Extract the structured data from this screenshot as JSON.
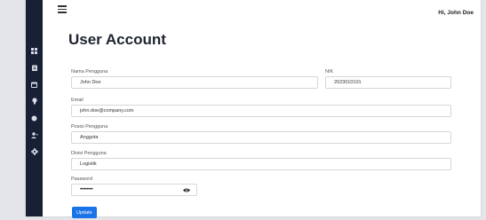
{
  "header": {
    "greeting": "Hi, John Doe"
  },
  "page": {
    "title": "User Account"
  },
  "sidebar": {
    "items": [
      {
        "icon": "grid-icon"
      },
      {
        "icon": "clipboard-icon"
      },
      {
        "icon": "calendar-icon"
      },
      {
        "icon": "lightbulb-icon"
      },
      {
        "icon": "circle-icon"
      },
      {
        "icon": "user-add-icon"
      },
      {
        "icon": "settings-icon"
      }
    ]
  },
  "form": {
    "nama": {
      "label": "Nama Pengguna",
      "value": "John Doe"
    },
    "nik": {
      "label": "NIK",
      "value": "2023010101"
    },
    "email": {
      "label": "Email",
      "value": "john.doe@company.com"
    },
    "posisi": {
      "label": "Posisi Pengguna",
      "value": "Anggota"
    },
    "divisi": {
      "label": "Divisi Pengguna",
      "value": "Logistik"
    },
    "password": {
      "label": "Password",
      "value": "••••••••"
    },
    "submit_label": "Update"
  },
  "colors": {
    "sidebar": "#172035",
    "accent": "#1a73e8"
  }
}
